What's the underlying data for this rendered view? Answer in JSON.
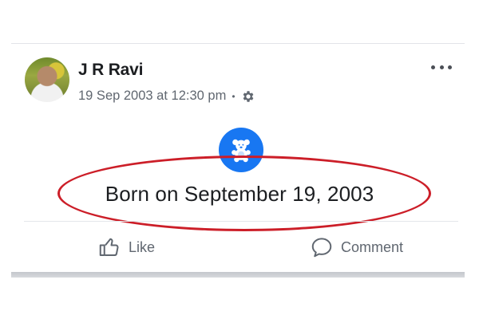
{
  "post": {
    "author": "J R Ravi",
    "timestamp": "19 Sep 2003 at 12:30 pm",
    "separator": "•",
    "privacy_icon": "gear-icon",
    "more_icon": "more-options-icon"
  },
  "life_event": {
    "icon": "teddy-bear-icon",
    "text": "Born on September 19, 2003"
  },
  "actions": {
    "like_label": "Like",
    "comment_label": "Comment"
  },
  "colors": {
    "accent": "#1877f2",
    "annotation": "#cc1e28",
    "meta_text": "#606770"
  }
}
